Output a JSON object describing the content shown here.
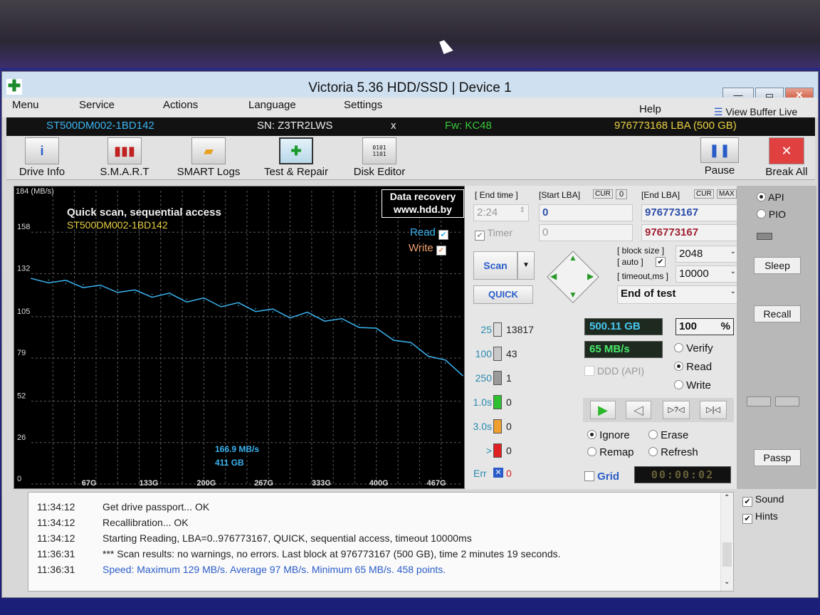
{
  "window": {
    "title": "Victoria 5.36 HDD/SSD | Device 1"
  },
  "menu": {
    "items": [
      "Menu",
      "Service",
      "Actions",
      "Language",
      "Settings",
      "Help"
    ],
    "view_buffer": "View Buffer Live"
  },
  "drive": {
    "model": "ST500DM002-1BD142",
    "sn": "SN: Z3TR2LWS",
    "x": "x",
    "fw": "Fw: KC48",
    "lba": "976773168 LBA (500 GB)"
  },
  "toolbar": {
    "tabs": [
      "Drive Info",
      "S.M.A.R.T",
      "SMART Logs",
      "Test & Repair",
      "Disk Editor"
    ],
    "pause": "Pause",
    "break_all": "Break All"
  },
  "graph": {
    "unit_label": "184 (MB/s)",
    "title": "Quick scan, sequential access",
    "model": "ST500DM002-1BD142",
    "ad_line1": "Data recovery",
    "ad_line2": "www.hdd.by",
    "read_label": "Read",
    "write_label": "Write",
    "y_ticks": [
      "158",
      "132",
      "105",
      "79",
      "52",
      "26",
      "0"
    ],
    "x_ticks": [
      "67G",
      "133G",
      "200G",
      "267G",
      "333G",
      "400G",
      "467G"
    ],
    "cursor_speed": "166.9 MB/s",
    "cursor_pos": "411 GB"
  },
  "chart_data": {
    "type": "line",
    "title": "Quick scan, sequential access",
    "xlabel": "",
    "ylabel": "184 (MB/s)",
    "xlim": [
      0,
      500
    ],
    "ylim": [
      0,
      184
    ],
    "series": [
      {
        "name": "Read",
        "x": [
          0,
          20,
          40,
          60,
          80,
          100,
          120,
          140,
          160,
          180,
          200,
          220,
          240,
          260,
          280,
          300,
          320,
          340,
          360,
          380,
          400,
          420,
          440,
          460,
          480,
          500
        ],
        "y": [
          129,
          128,
          126,
          125,
          123,
          122,
          120,
          119,
          118,
          116,
          115,
          113,
          112,
          110,
          108,
          106,
          106,
          104,
          102,
          100,
          96,
          92,
          87,
          82,
          76,
          68
        ]
      }
    ]
  },
  "params": {
    "end_time_label": "[ End time ]",
    "end_time": "2:24",
    "timer_label": "Timer",
    "start_lba_label": "[Start LBA]",
    "cur": "CUR",
    "zero": "0",
    "end_lba_label": "[End LBA]",
    "max": "MAX",
    "start_lba": "0",
    "start_lba2": "0",
    "end_lba": "976773167",
    "end_lba2": "976773167",
    "scan": "Scan",
    "quick": "QUICK",
    "block_size_label": "[ block size ]",
    "auto_label": "[ auto ]",
    "block_size": "2048",
    "timeout_label": "[ timeout,ms ]",
    "timeout": "10000",
    "end_of_test": "End of test"
  },
  "stats": {
    "rows": [
      {
        "label": "25",
        "count": "13817",
        "color": "#dcdcdc"
      },
      {
        "label": "100",
        "count": "43",
        "color": "#c8c8c8"
      },
      {
        "label": "250",
        "count": "1",
        "color": "#9a9a9a"
      },
      {
        "label": "1.0s",
        "count": "0",
        "color": "#2ec02e"
      },
      {
        "label": "3.0s",
        "count": "0",
        "color": "#f0a030"
      },
      {
        "label": ">",
        "count": "0",
        "color": "#e02020"
      }
    ],
    "err_label": "Err",
    "err_count": "0",
    "size": "500.11 GB",
    "percent": "100",
    "pct_sign": "%",
    "speed": "65 MB/s",
    "ddd": "DDD (API)",
    "verify": "Verify",
    "read": "Read",
    "write": "Write",
    "ignore": "Ignore",
    "erase": "Erase",
    "remap": "Remap",
    "refresh": "Refresh",
    "grid": "Grid",
    "timer": "00:00:02"
  },
  "side": {
    "api": "API",
    "pio": "PIO",
    "sleep": "Sleep",
    "recall": "Recall",
    "passp": "Passp",
    "sound": "Sound",
    "hints": "Hints"
  },
  "log": [
    {
      "time": "11:34:12",
      "text": "Get drive passport... OK",
      "color": "#222"
    },
    {
      "time": "11:34:12",
      "text": "Recallibration... OK",
      "color": "#222"
    },
    {
      "time": "11:34:12",
      "text": "Starting Reading, LBA=0..976773167, QUICK, sequential access, timeout 10000ms",
      "color": "#222"
    },
    {
      "time": "11:36:31",
      "text": "*** Scan results: no warnings, no errors. Last block at 976773167 (500 GB), time 2 minutes 19 seconds.",
      "color": "#222"
    },
    {
      "time": "11:36:31",
      "text": "Speed: Maximum 129 MB/s. Average 97 MB/s. Minimum 65 MB/s. 458 points.",
      "color": "#2a5cc8"
    }
  ]
}
